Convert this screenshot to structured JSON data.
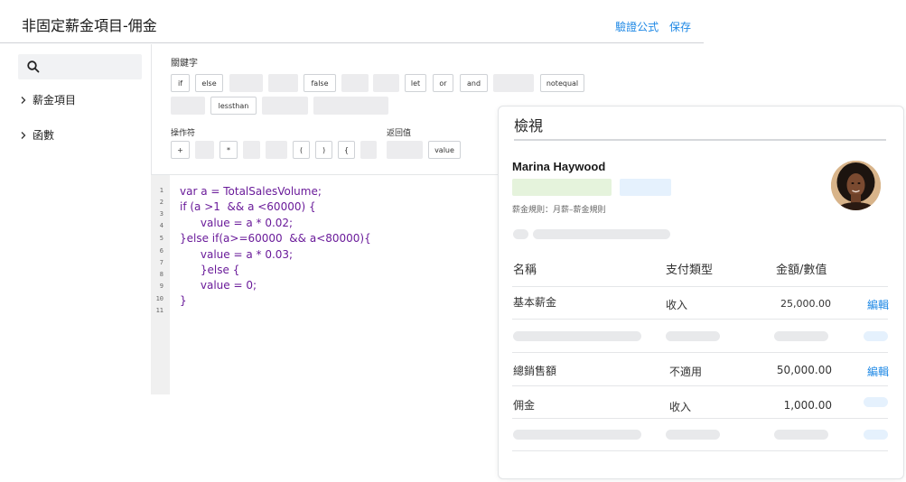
{
  "header": {
    "title": "非固定薪金項目-佣金",
    "actions": {
      "validate": "驗證公式",
      "save": "保存"
    }
  },
  "sidebar": {
    "items": [
      {
        "label": "薪金項目"
      },
      {
        "label": "函數"
      }
    ]
  },
  "keywords": {
    "label": "關鍵字",
    "chips": [
      "if",
      "else",
      "false",
      "let",
      "or",
      "and",
      "notequal",
      "lessthan"
    ]
  },
  "operators": {
    "label": "操作符",
    "chips": [
      "+",
      "*",
      "(",
      ")",
      "{"
    ]
  },
  "returns": {
    "label": "返回值",
    "chips": [
      "value"
    ]
  },
  "code": {
    "line_numbers": [
      "1",
      "2",
      "3",
      "4",
      "5",
      "6",
      "7",
      "8",
      "9",
      "10",
      "11"
    ],
    "lines": [
      "var a = TotalSalesVolume;",
      "if (a >1  && a <60000) {",
      "      value = a * 0.02;",
      "}else if(a>=60000  && a<80000){",
      "      value = a * 0.03;",
      "      }else {",
      "      value = 0;",
      "}"
    ]
  },
  "preview": {
    "title": "檢視",
    "employee_name": "Marina Haywood",
    "rule_text": "薪金規則：月薪–薪金規則",
    "columns": {
      "name": "名稱",
      "pay_type": "支付類型",
      "amount": "金額/數值"
    },
    "rows": [
      {
        "name": "基本薪金",
        "pay_type": "收入",
        "amount": "25,000.00",
        "action": "編輯"
      },
      {
        "name": "總銷售額",
        "pay_type": "不適用",
        "amount": "50,000.00",
        "action": "編輯"
      },
      {
        "name": "佣金",
        "pay_type": "收入",
        "amount": "1,000.00"
      }
    ]
  },
  "colors": {
    "accent": "#1e88e5",
    "code_keyword": "#6a1b9a",
    "placeholder": "#ececee"
  }
}
